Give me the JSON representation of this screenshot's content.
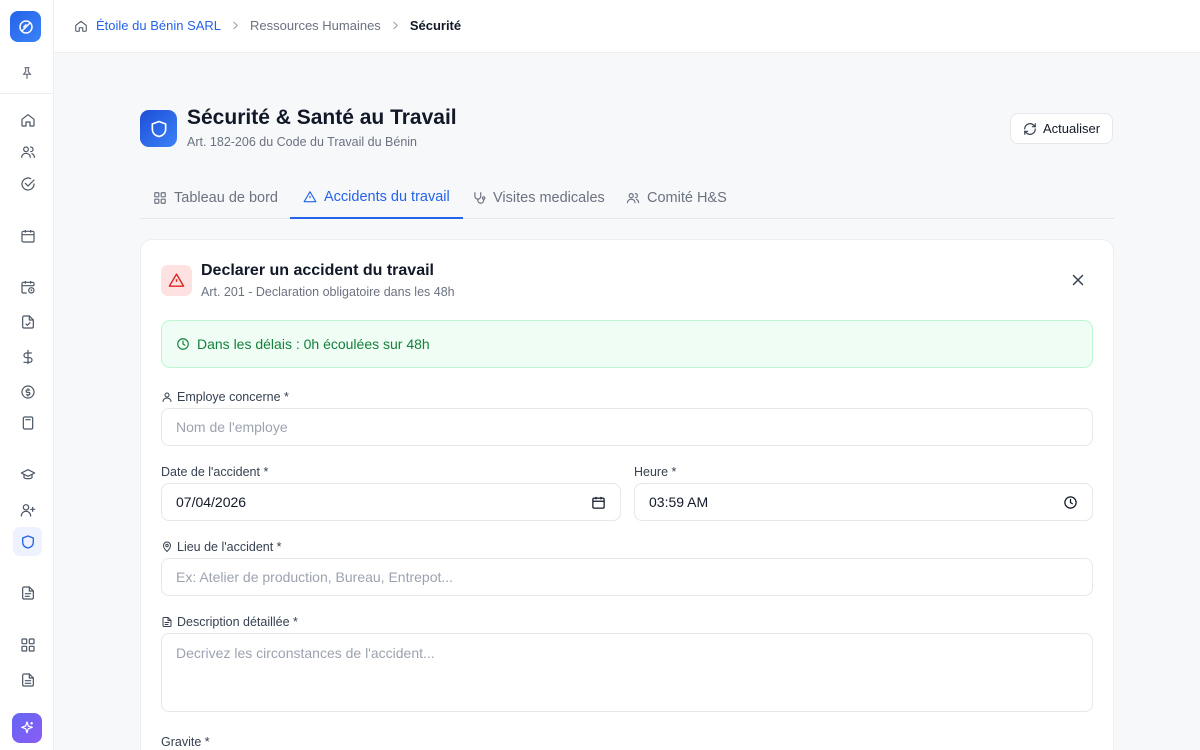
{
  "breadcrumb": {
    "home": "Étoile du Bénin SARL",
    "section": "Ressources Humaines",
    "current": "Sécurité"
  },
  "page": {
    "title": "Sécurité & Santé au Travail",
    "subtitle": "Art. 182-206 du Code du Travail du Bénin",
    "refresh_label": "Actualiser"
  },
  "tabs": [
    {
      "label": "Tableau de bord",
      "icon": "grid-icon",
      "active": false
    },
    {
      "label": "Accidents du travail",
      "icon": "warning-icon",
      "active": true
    },
    {
      "label": "Visites medicales",
      "icon": "stethoscope-icon",
      "active": false
    },
    {
      "label": "Comité H&S",
      "icon": "users-icon",
      "active": false
    }
  ],
  "form": {
    "title": "Declarer un accident du travail",
    "subtitle": "Art. 201 - Declaration obligatoire dans les 48h",
    "deadline_status": "Dans les délais : 0h écoulées sur 48h",
    "employee_label": "Employe concerne *",
    "employee_placeholder": "Nom de l'employe",
    "date_label": "Date de l'accident *",
    "date_value": "07/04/2026",
    "time_label": "Heure *",
    "time_value": "03:59 AM",
    "location_label": "Lieu de l'accident *",
    "location_placeholder": "Ex: Atelier de production, Bureau, Entrepot...",
    "description_label": "Description détaillée *",
    "description_placeholder": "Decrivez les circonstances de l'accident...",
    "severity_label": "Gravite *"
  },
  "colors": {
    "accent": "#2563eb",
    "success_bg": "#f0fdf4",
    "success_text": "#15803d",
    "danger": "#dc2626"
  }
}
